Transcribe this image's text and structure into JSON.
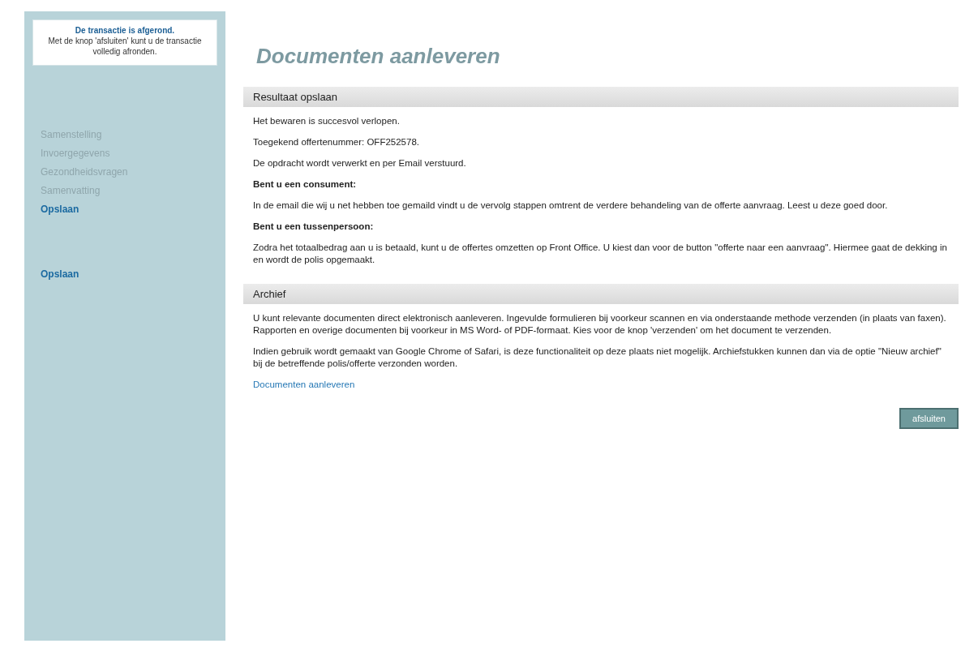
{
  "notice": {
    "title": "De transactie is afgerond.",
    "text": "Met de knop 'afsluiten' kunt u de transactie volledig afronden."
  },
  "sidebar": {
    "steps": [
      {
        "label": "Samenstelling",
        "selected": false
      },
      {
        "label": "Invoergegevens",
        "selected": false
      },
      {
        "label": "Gezondheidsvragen",
        "selected": false
      },
      {
        "label": "Samenvatting",
        "selected": false
      },
      {
        "label": "Opslaan",
        "selected": true
      }
    ],
    "extra_items": [
      {
        "label": "Opslaan",
        "selected": true
      }
    ]
  },
  "page_title": "Documenten aanleveren",
  "sections": [
    {
      "heading": "Resultaat opslaan",
      "paragraphs": [
        {
          "kind": "text",
          "text": "Het bewaren is succesvol verlopen."
        },
        {
          "kind": "text",
          "text": "Toegekend offertenummer: OFF252578."
        },
        {
          "kind": "text",
          "text": "De opdracht wordt verwerkt en per Email verstuurd."
        },
        {
          "kind": "heading",
          "text": "Bent u een consument:"
        },
        {
          "kind": "text",
          "text": "In de email die wij u net hebben toe gemaild vindt u de vervolg stappen omtrent de verdere behandeling van de offerte aanvraag. Leest u deze goed door."
        },
        {
          "kind": "heading",
          "text": "Bent u een tussenpersoon:"
        },
        {
          "kind": "text",
          "text": "Zodra het totaalbedrag aan u is betaald, kunt u de offertes omzetten op Front Office. U kiest dan voor de button \"offerte naar een aanvraag\". Hiermee gaat de dekking in en wordt de polis opgemaakt."
        }
      ]
    },
    {
      "heading": "Archief",
      "paragraphs": [
        {
          "kind": "text",
          "text": "U kunt relevante documenten direct elektronisch aanleveren. Ingevulde formulieren bij voorkeur scannen en via onderstaande methode verzenden (in plaats van faxen). Rapporten en overige documenten bij voorkeur in MS Word- of PDF-formaat. Kies voor de knop 'verzenden' om het document te verzenden."
        },
        {
          "kind": "text",
          "text": "Indien gebruik wordt gemaakt van Google Chrome of Safari, is deze functionaliteit op deze plaats niet mogelijk. Archiefstukken kunnen dan via de optie \"Nieuw archief\" bij de betreffende polis/offerte verzonden worden."
        },
        {
          "kind": "link",
          "text": "Documenten aanleveren"
        }
      ]
    }
  ],
  "button": "afsluiten"
}
